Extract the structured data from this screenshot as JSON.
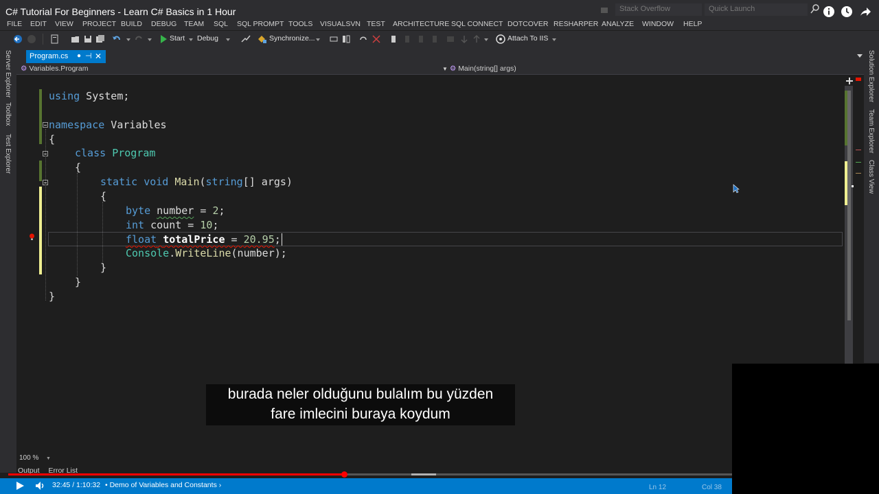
{
  "window": {
    "video_title": "C# Tutorial For Beginners - Learn C# Basics in 1 Hour",
    "stack_overflow_placeholder": "Stack Overflow",
    "quick_launch_placeholder": "Quick Launch"
  },
  "menu": [
    "FILE",
    "EDIT",
    "VIEW",
    "PROJECT",
    "BUILD",
    "DEBUG",
    "TEAM",
    "SQL",
    "SQL PROMPT",
    "TOOLS",
    "VISUALSVN",
    "TEST",
    "ARCHITECTURE",
    "SQL CONNECT",
    "DOTCOVER",
    "RESHARPER",
    "ANALYZE",
    "WINDOW",
    "HELP"
  ],
  "toolbar": {
    "start_label": "Start",
    "config_label": "Debug",
    "sync_label": "Synchronize...",
    "attach_label": "Attach To IIS"
  },
  "left_tools": [
    "Server Explorer",
    "Toolbox",
    "Test Explorer"
  ],
  "right_tools": [
    "Solution Explorer",
    "Team Explorer",
    "Class View"
  ],
  "document": {
    "tab_label": "Program.cs",
    "modified_marker": "●",
    "pin": "⊣",
    "close": "✕"
  },
  "navbar": {
    "type_scope": "Variables.Program",
    "member_scope": "Main(string[] args)"
  },
  "code": {
    "l1_kw": "using",
    "l1_rest": " System;",
    "l3_kw": "namespace",
    "l3_rest": " Variables",
    "open_brace": "{",
    "close_brace": "}",
    "l5_kw": "class",
    "l5_type": "Program",
    "l7_kw1": "static",
    "l7_kw2": "void",
    "l7_fn": "Main",
    "l7_kw3": "string",
    "l7_rest": "[] args)",
    "l9_type": "byte",
    "l9_var": "number",
    "l9_rest": " = ",
    "l9_num": "2",
    "l10_type": "int",
    "l10_var": " count",
    "l10_num": "10",
    "l11_type": "float",
    "l11_var": "totalPrice",
    "l11_num": "20.95",
    "l12_obj": "Console",
    "l12_fn": "WriteLine",
    "l12_arg": "(number);",
    "semicolon": ";",
    "equals": " = "
  },
  "status": {
    "zoom": "100 %",
    "bottom_tabs": [
      "Output",
      "Error List"
    ],
    "line": "Ln 12",
    "column": "Col 38"
  },
  "video": {
    "caption_line1": "burada neler olduğunu bulalım bu yüzden",
    "caption_line2": "fare imlecini buraya koydum",
    "timecode": "32:45 / 1:10:32",
    "chapter": "• Demo of Variables and Constants ›",
    "progress_fraction": 0.4643
  },
  "colors": {
    "accent": "#007acc",
    "keyword": "#569cd6",
    "type": "#4ec9b0",
    "method": "#dcdcaa",
    "number": "#b5cea8",
    "error_squiggle": "#e51400",
    "progress": "#ff0000"
  },
  "icons": [
    "back-arrow-icon",
    "forward-arrow-icon",
    "new-project-icon",
    "open-file-icon",
    "save-icon",
    "save-all-icon",
    "undo-icon",
    "redo-icon",
    "start-play-icon",
    "synchronize-icon",
    "bookmark-icon",
    "attach-icon",
    "lightbulb-icon",
    "info-icon",
    "clock-icon",
    "share-icon",
    "play-icon",
    "volume-icon",
    "search-icon"
  ]
}
